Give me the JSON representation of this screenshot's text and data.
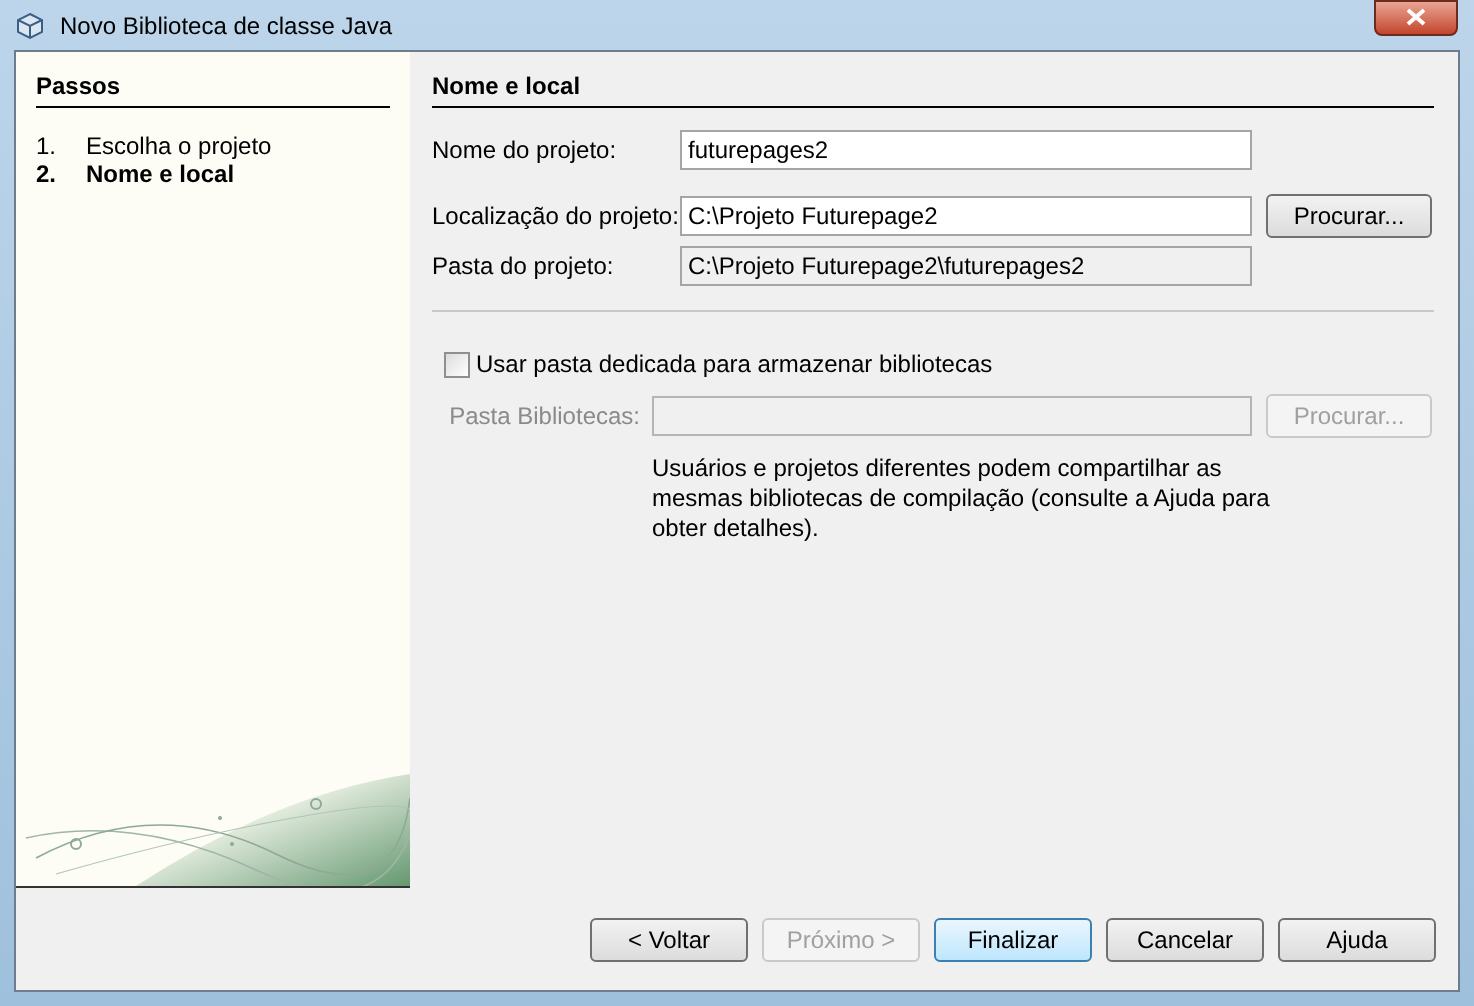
{
  "window": {
    "title": "Novo Biblioteca de classe Java"
  },
  "steps": {
    "title": "Passos",
    "items": [
      {
        "number": "1.",
        "label": "Escolha o projeto",
        "selected": false
      },
      {
        "number": "2.",
        "label": "Nome e local",
        "selected": true
      }
    ]
  },
  "panel": {
    "title": "Nome e local",
    "fields": [
      {
        "label": "Nome do projeto:",
        "value": "futurepages2",
        "readonly": false
      },
      {
        "label": "Localização do projeto:",
        "value": "C:\\Projeto Futurepage2",
        "readonly": false,
        "button": "Procurar..."
      },
      {
        "label": "Pasta do projeto:",
        "value": "C:\\Projeto Futurepage2\\futurepages2",
        "readonly": true
      }
    ],
    "checkbox": {
      "label": "Usar pasta dedicada para armazenar bibliotecas",
      "checked": false
    },
    "libraries": {
      "label": "Pasta Bibliotecas:",
      "disabled": true,
      "button": "Procurar..."
    },
    "note": "Usuários e projetos diferentes podem compartilhar as mesmas bibliotecas de compilação (consulte a Ajuda para obter detalhes)."
  },
  "buttons": [
    {
      "label": "< Voltar",
      "disabled": false,
      "default": false
    },
    {
      "label": "Próximo >",
      "disabled": true,
      "default": false
    },
    {
      "label": "Finalizar",
      "disabled": false,
      "default": true
    },
    {
      "label": "Cancelar",
      "disabled": false,
      "default": false
    },
    {
      "label": "Ajuda",
      "disabled": false,
      "default": false
    }
  ]
}
